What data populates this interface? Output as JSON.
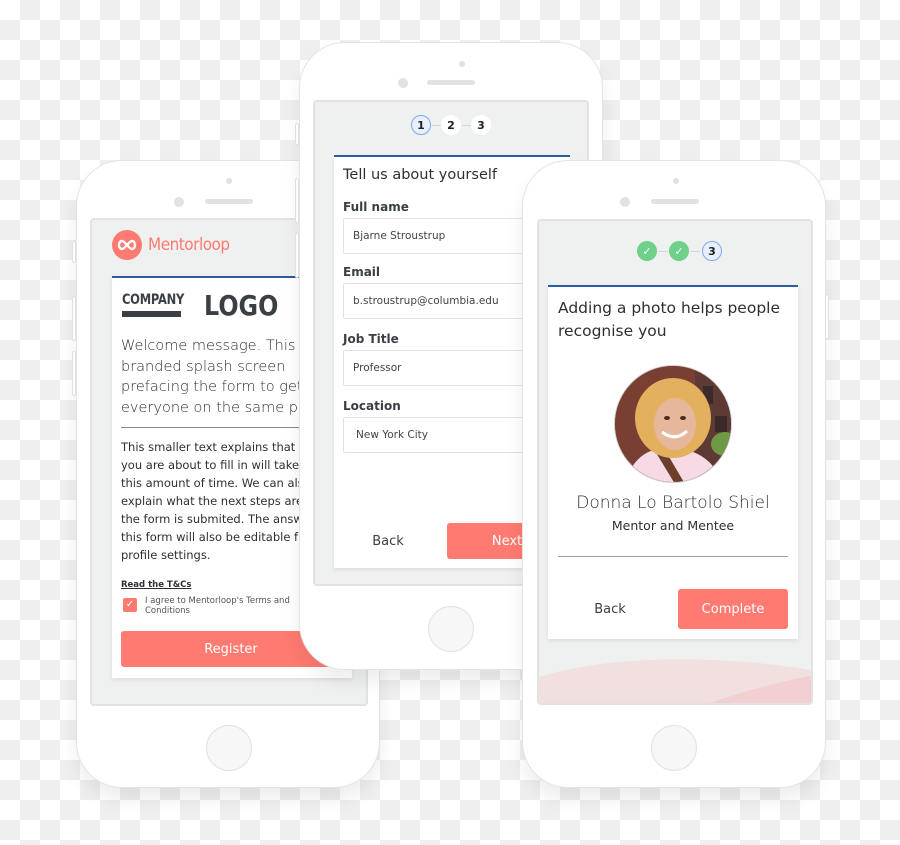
{
  "phone_left": {
    "brand_name": "Mentorloop",
    "company_logo": {
      "top": "COMPANY",
      "big": "LOGO"
    },
    "welcome_message": "Welcome message. This is a branded splash screen prefacing the form to get everyone on the same page.",
    "explanation_text": "This smaller text explains that the form you are about to fill in will take aprox this amount of time. We can also explain what the next steps are after the form is submited. The answers to this form will also be editable from your profile settings.",
    "terms_link": "Read the T&Cs",
    "agree_label": "I agree to Mentorloop's Terms and Conditions",
    "agree_checked": true,
    "register_label": "Register"
  },
  "phone_middle": {
    "steps": [
      "1",
      "2",
      "3"
    ],
    "current_step": 1,
    "heading": "Tell us about yourself",
    "fields": [
      {
        "label": "Full name",
        "value": "Bjarne Stroustrup"
      },
      {
        "label": "Email",
        "value": "b.stroustrup@columbia.edu"
      },
      {
        "label": "Job Title",
        "value": "Professor"
      },
      {
        "label": "Location",
        "value": "New York City"
      }
    ],
    "back_label": "Back",
    "next_label": "Next"
  },
  "phone_right": {
    "steps": [
      "✓",
      "✓",
      "3"
    ],
    "current_step": 3,
    "heading": "Adding a photo helps people recognise you",
    "profile_name": "Donna Lo Bartolo Shiel",
    "profile_role": "Mentor and Mentee",
    "back_label": "Back",
    "complete_label": "Complete"
  },
  "colors": {
    "accent": "#ff7a70",
    "divider_blue": "#2a5ea0",
    "step_done": "#6fd08a",
    "step_active": "#7fa8ec"
  }
}
